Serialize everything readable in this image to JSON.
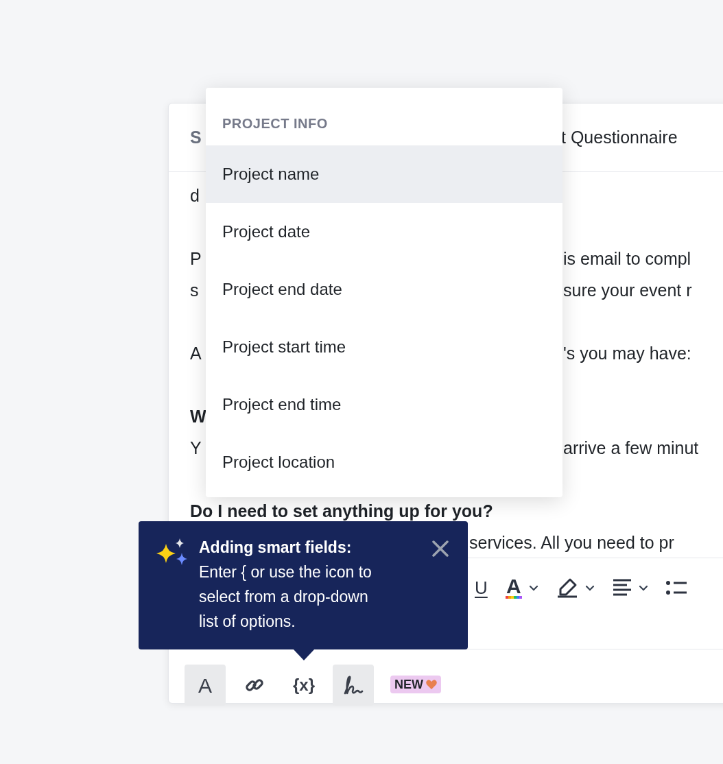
{
  "editor": {
    "subject_label": "S",
    "subject_value": "t Questionnaire",
    "paragraphs": [
      [
        {
          "start": "d",
          "bold": false
        }
      ],
      [
        {
          "start": "P",
          "rest": "is email to compl",
          "bold": false
        },
        {
          "start": "s",
          "rest": "sure your event r",
          "bold": false
        }
      ],
      [
        {
          "start": "A",
          "rest": "'s you may have:",
          "bold": false
        }
      ],
      [
        {
          "start": "W",
          "bold": true
        },
        {
          "start": "Y",
          "rest": "arrive a few minut",
          "bold": false
        }
      ],
      [
        {
          "start": "Do I need to set anything up for you?",
          "bold": true
        },
        {
          "rest": "services. All you need to pr",
          "bold": false
        }
      ]
    ],
    "format_toolbar": [
      {
        "kind": "underline",
        "label": "U"
      },
      {
        "kind": "text-color",
        "label": "A"
      },
      {
        "kind": "highlight"
      },
      {
        "kind": "align"
      },
      {
        "kind": "bullet-list"
      }
    ],
    "bottom_toolbar": [
      {
        "kind": "text",
        "label": "A",
        "active": true
      },
      {
        "kind": "link",
        "active": false
      },
      {
        "kind": "text",
        "label": "{x}",
        "active": false
      },
      {
        "kind": "signature",
        "active": true
      }
    ],
    "badge": {
      "label": "NEW"
    }
  },
  "menu": {
    "heading": "PROJECT INFO",
    "items": [
      {
        "label": "Project name",
        "selected": true
      },
      {
        "label": "Project date",
        "selected": false
      },
      {
        "label": "Project end date",
        "selected": false
      },
      {
        "label": "Project start time",
        "selected": false
      },
      {
        "label": "Project end time",
        "selected": false
      },
      {
        "label": "Project location",
        "selected": false
      }
    ]
  },
  "tooltip": {
    "title": "Adding smart fields:",
    "text": "Enter { or use the icon to select from a drop-down list of options."
  }
}
